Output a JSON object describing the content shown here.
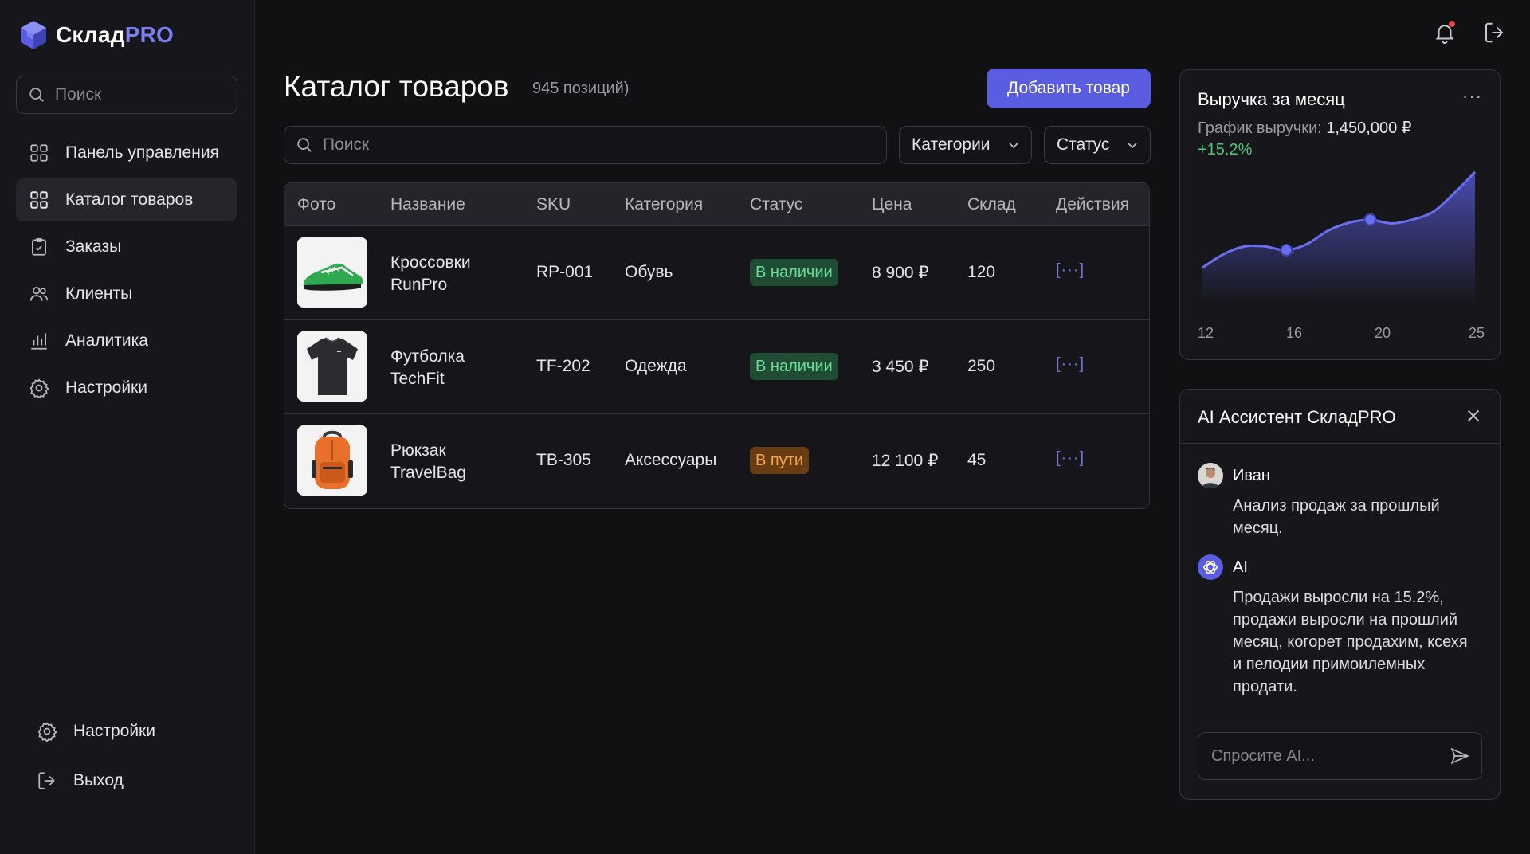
{
  "brand": {
    "name_main": "Склад",
    "name_accent": "PRO"
  },
  "sidebar": {
    "search_placeholder": "Поиск",
    "items": [
      {
        "label": "Панель управления",
        "icon": "grid-icon"
      },
      {
        "label": "Каталог товаров",
        "icon": "grid-icon",
        "active": true
      },
      {
        "label": "Заказы",
        "icon": "clipboard-icon"
      },
      {
        "label": "Клиенты",
        "icon": "users-icon"
      },
      {
        "label": "Аналитика",
        "icon": "bar-chart-icon"
      },
      {
        "label": "Настройки",
        "icon": "gear-icon"
      }
    ],
    "bottom": [
      {
        "label": "Настройки",
        "icon": "gear-icon"
      },
      {
        "label": "Выход",
        "icon": "logout-icon"
      }
    ]
  },
  "main": {
    "title": "Каталог товаров",
    "count": "945 позиций)",
    "add_button": "Добавить товар",
    "search_placeholder": "Поиск",
    "filters": {
      "category": "Категории",
      "status": "Статус"
    },
    "table": {
      "headers": [
        "Фото",
        "Название",
        "SKU",
        "Категория",
        "Статус",
        "Цена",
        "Склад",
        "Действия"
      ],
      "rows": [
        {
          "name_line1": "Кроссовки",
          "name_line2": "RunPro",
          "sku": "RP-001",
          "category": "Обувь",
          "status": "В наличии",
          "status_color": "#1e4d33",
          "price": "8 900 ₽",
          "stock": "120",
          "actions": "[···]",
          "photo": "sneaker-image"
        },
        {
          "name_line1": "Футболка",
          "name_line2": "TechFit",
          "sku": "TF-202",
          "category": "Одежда",
          "status": "В наличии",
          "status_color": "#1e4d33",
          "price": "3 450 ₽",
          "stock": "250",
          "actions": "[···]",
          "photo": "tshirt-image"
        },
        {
          "name_line1": "Рюкзак",
          "name_line2": "TravelBag",
          "sku": "TB-305",
          "category": "Аксессуары",
          "status": "В пути",
          "status_color": "#6a3c12",
          "price": "12 100 ₽",
          "stock": "45",
          "actions": "[···]",
          "photo": "backpack-image"
        }
      ]
    }
  },
  "revenue": {
    "title": "Выручка за месяц",
    "more": "···",
    "subtitle_label": "График выручки:",
    "subtitle_value": "1,450,000 ₽",
    "growth": "+15.2%",
    "accent": "#5a5de0"
  },
  "chart_data": {
    "type": "area",
    "x_ticks": [
      "12",
      "16",
      "20",
      "25"
    ],
    "x": [
      12,
      13,
      14,
      15,
      16,
      17,
      18,
      19,
      20,
      21,
      22,
      23,
      24,
      25
    ],
    "y": [
      0.0,
      0.36,
      0.57,
      0.57,
      0.47,
      0.64,
      1.0,
      1.21,
      1.29,
      1.19,
      1.29,
      1.5,
      2.0,
      2.57
    ],
    "highlighted_points_x": [
      16,
      20
    ],
    "ylabel": "",
    "xlabel": "",
    "grid": false
  },
  "assistant": {
    "title": "AI Ассистент СкладPRO",
    "messages": [
      {
        "author": "Иван",
        "text": "Анализ продаж за прошлый месяц.",
        "avatar": "user-avatar"
      },
      {
        "author": "AI",
        "text": "Продажи выросли на 15.2%, продажи выросли на прошлий месяц, когорет продахим, ксехя и пелодии примоилемных продати.",
        "avatar": "ai-logo-icon"
      }
    ],
    "input_placeholder": "Спросите AI..."
  }
}
